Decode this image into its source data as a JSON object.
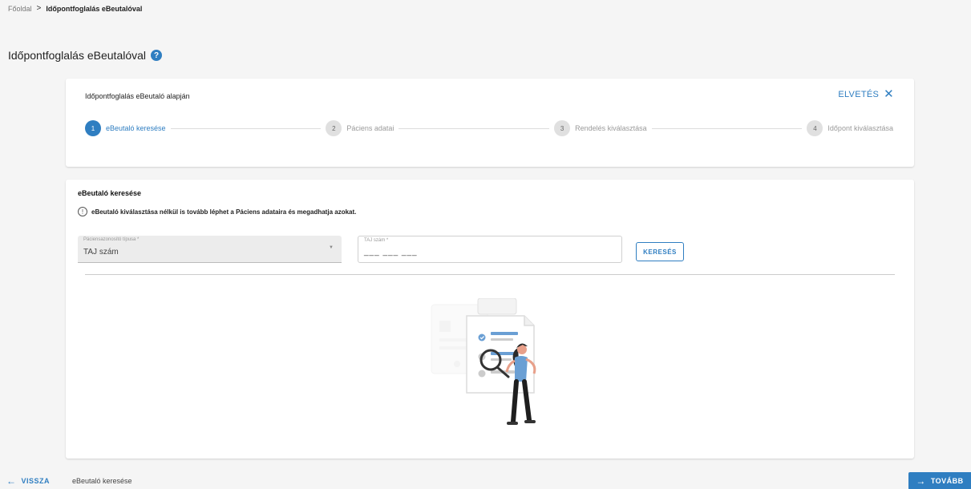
{
  "breadcrumb": {
    "home": "Főoldal",
    "separator": ">",
    "current": "Időpontfoglalás eBeutalóval"
  },
  "page": {
    "title": "Időpontfoglalás eBeutalóval",
    "help_icon": "question-circle-icon"
  },
  "stepper": {
    "title": "Időpontfoglalás eBeutaló alapján",
    "discard_label": "ELVETÉS",
    "discard_icon": "close-icon",
    "steps": [
      {
        "num": "1",
        "label": "eBeutaló keresése",
        "active": true
      },
      {
        "num": "2",
        "label": "Páciens adatai",
        "active": false
      },
      {
        "num": "3",
        "label": "Rendelés kiválasztása",
        "active": false
      },
      {
        "num": "4",
        "label": "Időpont kiválasztása",
        "active": false
      }
    ]
  },
  "search": {
    "section_title": "eBeutaló keresése",
    "info_text": "eBeutaló kiválasztása nélkül is tovább léphet a Páciens adataira és megadhatja azokat.",
    "id_type_label": "Páciensazonosító típusa *",
    "id_type_value": "TAJ szám",
    "taj_label": "TAJ szám *",
    "taj_value": "___ ___ ___",
    "search_button": "KERESÉS"
  },
  "footer": {
    "back_label": "VISSZA",
    "current_step": "eBeutaló keresése",
    "next_label": "TOVÁBB"
  },
  "colors": {
    "accent": "#2f7ec1",
    "background": "#f5f5f5",
    "illustration_accent": "#6a9fd4"
  }
}
